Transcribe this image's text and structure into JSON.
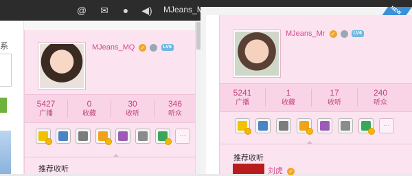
{
  "left_window": {
    "topbar": {
      "icons": [
        "at-icon",
        "mail-icon",
        "person-icon",
        "speaker-icon"
      ],
      "username": "MJeans_M"
    },
    "side_char": "系",
    "profile": {
      "username": "MJeans_MQ",
      "level": "LV6",
      "stats": [
        {
          "value": "5427",
          "label": "广播"
        },
        {
          "value": "0",
          "label": "收藏"
        },
        {
          "value": "30",
          "label": "收听"
        },
        {
          "value": "346",
          "label": "听众"
        }
      ],
      "apps": [
        {
          "icon": "app-qq-icon",
          "color": "#f2c200"
        },
        {
          "icon": "app-calendar-icon",
          "color": "#4b84c4"
        },
        {
          "icon": "app-search-icon",
          "color": "#7c7c7c"
        },
        {
          "icon": "app-pet-icon",
          "color": "#f0a21c"
        },
        {
          "icon": "app-purple-icon",
          "color": "#9d5bb7"
        },
        {
          "icon": "app-music-icon",
          "color": "#8b8b8b"
        },
        {
          "icon": "app-green-icon",
          "color": "#3aa65a"
        }
      ],
      "more_label": "···",
      "recommend_title": "推荐收听"
    }
  },
  "right_window": {
    "profile": {
      "username": "MJeans_Mr",
      "level": "LV6",
      "stats": [
        {
          "value": "5241",
          "label": "广播"
        },
        {
          "value": "1",
          "label": "收藏"
        },
        {
          "value": "17",
          "label": "收听"
        },
        {
          "value": "240",
          "label": "听众"
        }
      ],
      "apps": [
        {
          "icon": "app-qq-icon",
          "color": "#f2c200"
        },
        {
          "icon": "app-calendar-icon",
          "color": "#4b84c4"
        },
        {
          "icon": "app-search-icon",
          "color": "#7c7c7c"
        },
        {
          "icon": "app-pet-icon",
          "color": "#f0a21c"
        },
        {
          "icon": "app-purple-icon",
          "color": "#9d5bb7"
        },
        {
          "icon": "app-music-icon",
          "color": "#8b8b8b"
        },
        {
          "icon": "app-green-icon",
          "color": "#3aa65a"
        }
      ],
      "more_label": "···",
      "recommend_title": "推荐收听",
      "recommend_user": "刘虎"
    },
    "ribbon": "NEW"
  },
  "colors": {
    "accent_pink": "#d24a8b",
    "panel_bg": "#fbe3f0",
    "topbar_bg": "#2c2c2c"
  }
}
